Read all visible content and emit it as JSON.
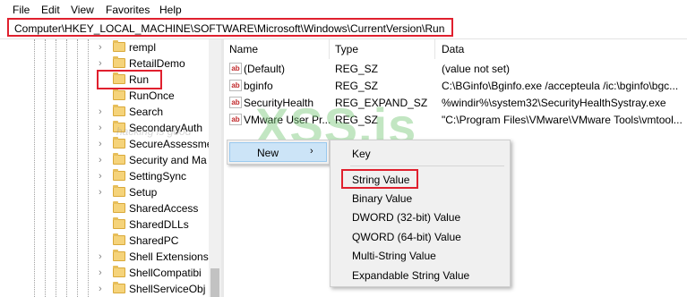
{
  "menu": [
    "File",
    "Edit",
    "View",
    "Favorites",
    "Help"
  ],
  "address": "Computer\\HKEY_LOCAL_MACHINE\\SOFTWARE\\Microsoft\\Windows\\CurrentVersion\\Run",
  "tree": [
    {
      "label": "rempl",
      "chevron": "›"
    },
    {
      "label": "RetailDemo",
      "chevron": "›"
    },
    {
      "label": "Run",
      "chevron": ""
    },
    {
      "label": "RunOnce",
      "chevron": ""
    },
    {
      "label": "Search",
      "chevron": "›"
    },
    {
      "label": "SecondaryAuth",
      "chevron": "›"
    },
    {
      "label": "SecureAssessmen",
      "chevron": "›"
    },
    {
      "label": "Security and Ma",
      "chevron": "›"
    },
    {
      "label": "SettingSync",
      "chevron": "›"
    },
    {
      "label": "Setup",
      "chevron": "›"
    },
    {
      "label": "SharedAccess",
      "chevron": ""
    },
    {
      "label": "SharedDLLs",
      "chevron": ""
    },
    {
      "label": "SharedPC",
      "chevron": ""
    },
    {
      "label": "Shell Extensions",
      "chevron": "›"
    },
    {
      "label": "ShellCompatibi",
      "chevron": "›"
    },
    {
      "label": "ShellServiceObj",
      "chevron": "›"
    }
  ],
  "columns": {
    "name": "Name",
    "type": "Type",
    "data": "Data"
  },
  "values": [
    {
      "name": "(Default)",
      "type": "REG_SZ",
      "data": "(value not set)"
    },
    {
      "name": "bginfo",
      "type": "REG_SZ",
      "data": "C:\\BGinfo\\Bginfo.exe /accepteula /ic:\\bginfo\\bgc..."
    },
    {
      "name": "SecurityHealth",
      "type": "REG_EXPAND_SZ",
      "data": "%windir%\\system32\\SecurityHealthSystray.exe"
    },
    {
      "name": "VMware User Pr...",
      "type": "REG_SZ",
      "data": "\"C:\\Program Files\\VMware\\VMware Tools\\vmtool..."
    }
  ],
  "context_menu": {
    "new_label": "New",
    "arrow": "›"
  },
  "submenu": [
    "Key",
    "String Value",
    "Binary Value",
    "DWORD (32-bit) Value",
    "QWORD (64-bit) Value",
    "Multi-String Value",
    "Expandable String Value"
  ],
  "watermark": "XSS.is",
  "watermark_small": "hacking is good",
  "colors": {
    "highlight_box": "#e0202e",
    "menu_hover": "#cce4f7",
    "folder": "#f5d37a"
  }
}
